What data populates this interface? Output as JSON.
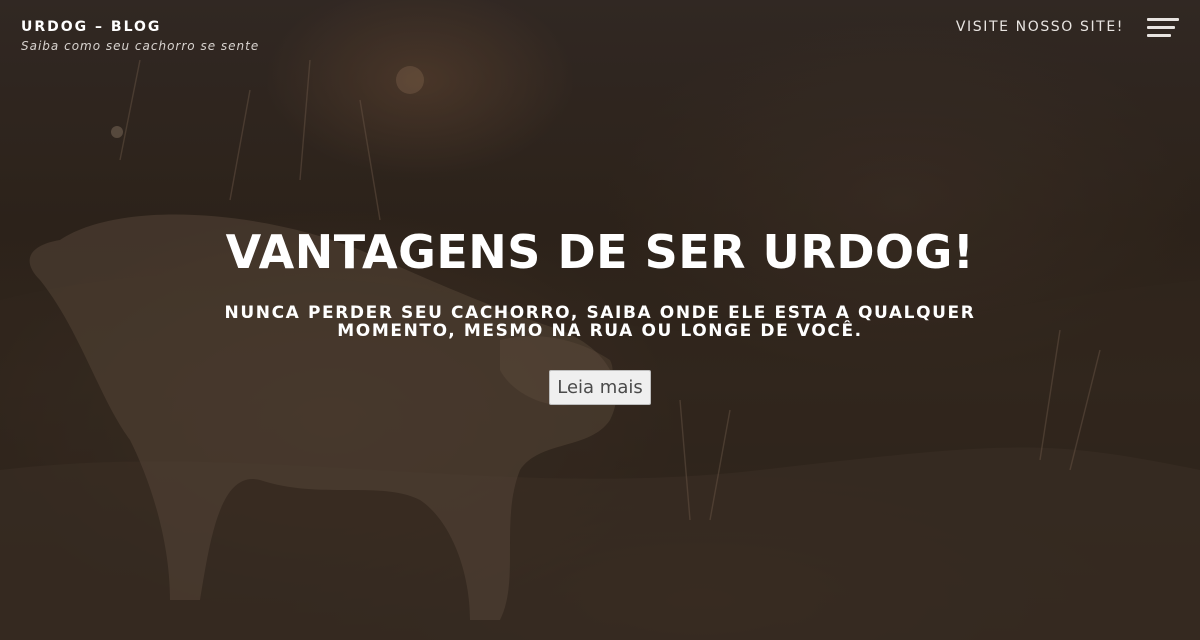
{
  "header": {
    "site_title": "URDOG – BLOG",
    "tagline": "Saiba como seu cachorro se sente",
    "nav_link": "VISITE NOSSO SITE!",
    "menu_icon": "hamburger-menu-icon"
  },
  "hero": {
    "title": "VANTAGENS DE SER URDOG!",
    "subtitle": "NUNCA PERDER SEU CACHORRO, SAIBA ONDE ELE ESTA A QUALQUER MOMENTO, MESMO NA RUA OU LONGE DE VOCÊ.",
    "button_label": "Leia mais"
  },
  "colors": {
    "text_primary": "#ffffff",
    "button_bg": "#efefef",
    "button_text": "#4a4a4a"
  }
}
